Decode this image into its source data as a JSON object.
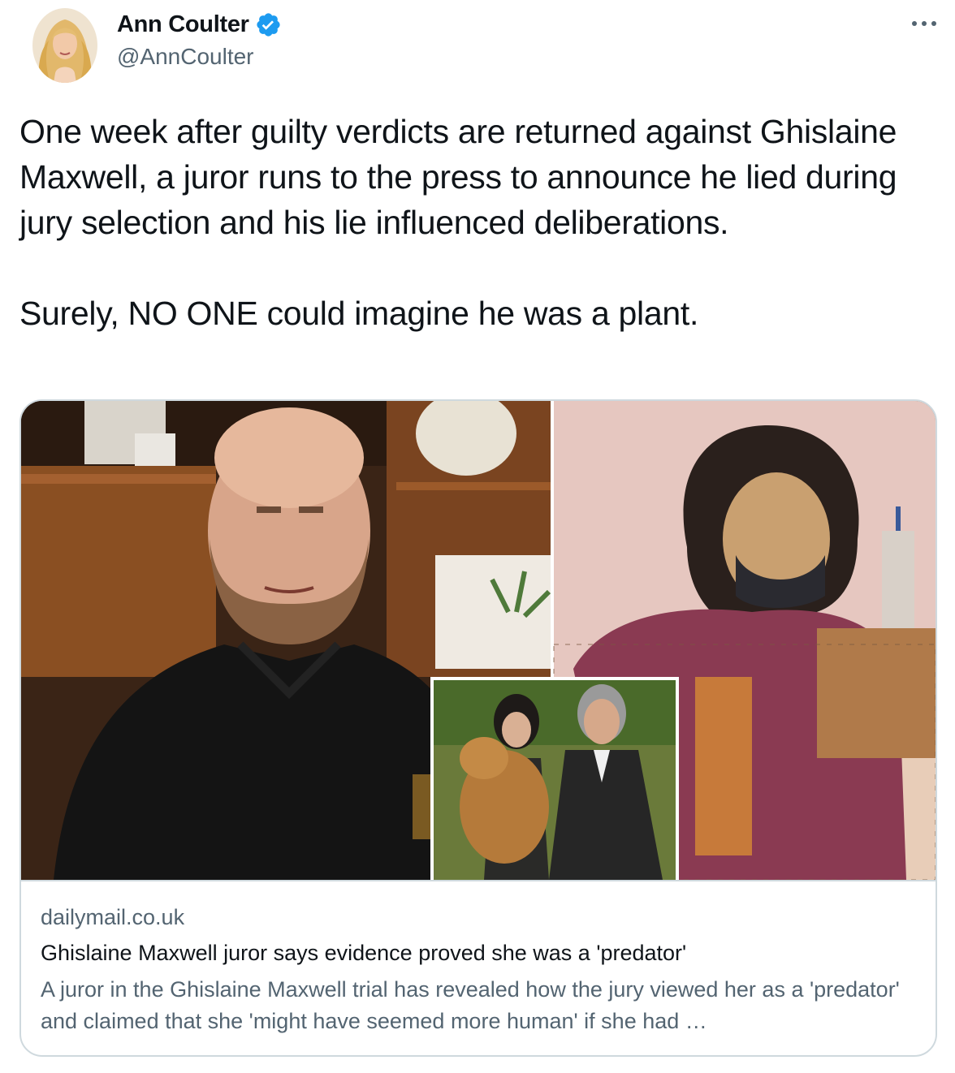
{
  "author": {
    "name": "Ann Coulter",
    "handle": "@AnnCoulter",
    "verified": true
  },
  "menu_icon": "more-horizontal-icon",
  "tweet": {
    "paragraphs": [
      "One week after guilty verdicts are returned against Ghislaine Maxwell, a juror runs to the press to announce he lied during jury selection and his lie influenced deliberations.",
      "Surely, NO ONE could imagine he was a plant."
    ]
  },
  "card": {
    "domain": "dailymail.co.uk",
    "title": "Ghislaine Maxwell juror says evidence proved she was a 'predator'",
    "description": "A juror in the Ghislaine Maxwell trial has revealed how the jury viewed her as a 'predator' and claimed that she 'might have seemed more human' if she had …"
  },
  "colors": {
    "text": "#0f1419",
    "secondary": "#536471",
    "border": "#cfd9de",
    "verified": "#1d9bf0"
  }
}
